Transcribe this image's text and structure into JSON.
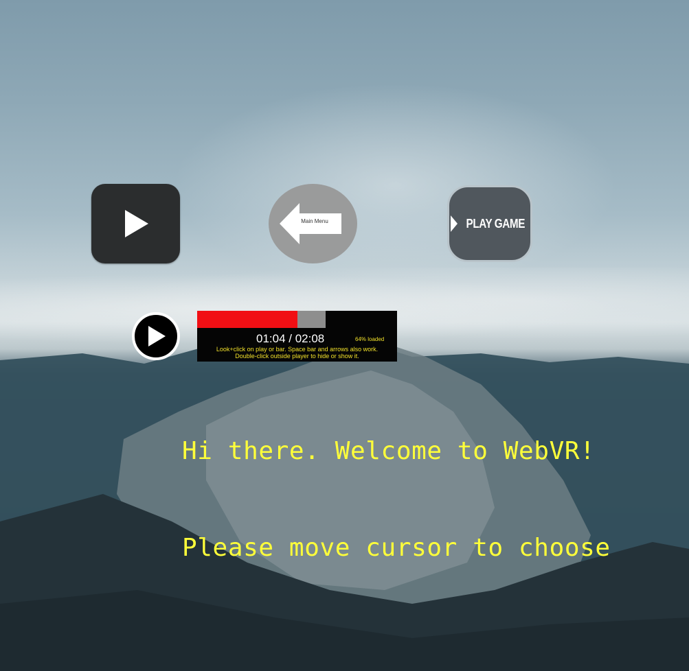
{
  "scene": {
    "background": "360-degree mountain landscape with cloudy sky"
  },
  "buttons": {
    "play_icon": "play-icon",
    "main_menu_label": "Main Menu",
    "main_menu_icon": "arrow-left-icon",
    "play_game_label": "PLAY GAME",
    "play_game_icon": "play-icon"
  },
  "player": {
    "current_time": "01:04",
    "total_time": "02:08",
    "time_display": "01:04 / 02:08",
    "loaded_label": "64% loaded",
    "played_fraction": 0.5,
    "loaded_fraction": 0.64,
    "hint_line1": "Look+click on play or bar. Space bar and arrows also work.",
    "hint_line2": "Double-click outside player to hide or show it.",
    "played_color": "#f10f14",
    "loaded_color": "#8e8e8e"
  },
  "message": {
    "line1": "Hi there. Welcome to WebVR!",
    "line2": "Please move cursor to choose",
    "color": "#ffff3a"
  }
}
